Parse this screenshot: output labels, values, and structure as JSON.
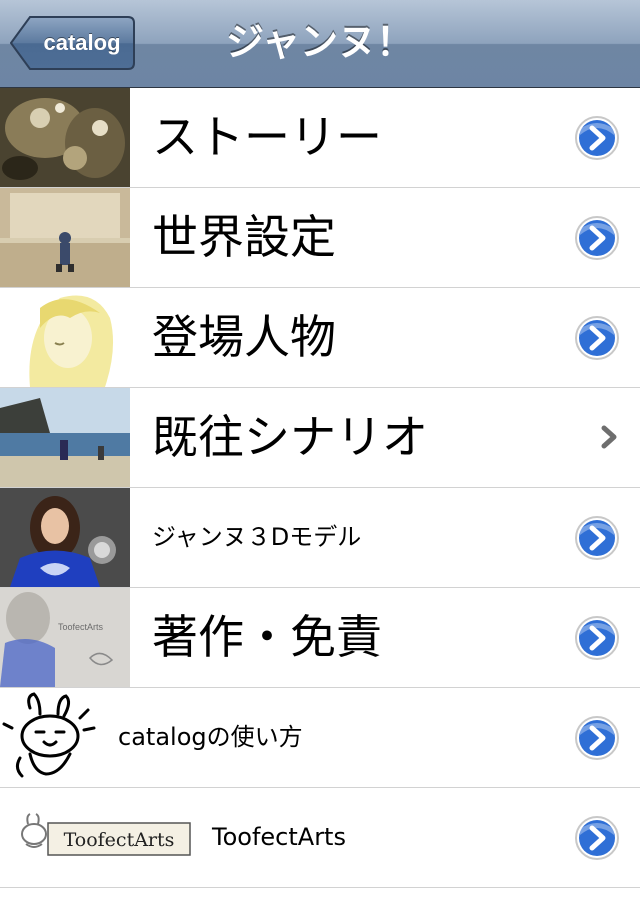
{
  "navbar": {
    "back_label": "catalog",
    "title": "ジャンヌ！"
  },
  "items": [
    {
      "label": "ストーリー",
      "size": "big",
      "accessory": "detail-disclosure",
      "thumb": "story-thumbnail"
    },
    {
      "label": "世界設定",
      "size": "big",
      "accessory": "detail-disclosure",
      "thumb": "world-thumbnail"
    },
    {
      "label": "登場人物",
      "size": "big",
      "accessory": "detail-disclosure",
      "thumb": "characters-thumbnail"
    },
    {
      "label": "既往シナリオ",
      "size": "big",
      "accessory": "chevron",
      "thumb": "scenario-thumbnail"
    },
    {
      "label": "ジャンヌ３Dモデル",
      "size": "small",
      "accessory": "detail-disclosure",
      "thumb": "model-thumbnail"
    },
    {
      "label": "著作・免責",
      "size": "big",
      "accessory": "detail-disclosure",
      "thumb": "copyright-thumbnail"
    },
    {
      "label": "catalogの使い方",
      "size": "small",
      "accessory": "detail-disclosure",
      "thumb": "usage-thumbnail"
    },
    {
      "label": "ToofectArts",
      "size": "small",
      "accessory": "detail-disclosure",
      "thumb": "toofectarts-thumbnail"
    }
  ],
  "thumb_text": {
    "logo": "ToofectArts",
    "watermark": "ToofectArts"
  },
  "colors": {
    "navbar_top": "#b6c5d7",
    "navbar_bottom": "#6d85a4",
    "disclosure_blue": "#2f6fd6",
    "separator": "#d2d2d2"
  }
}
